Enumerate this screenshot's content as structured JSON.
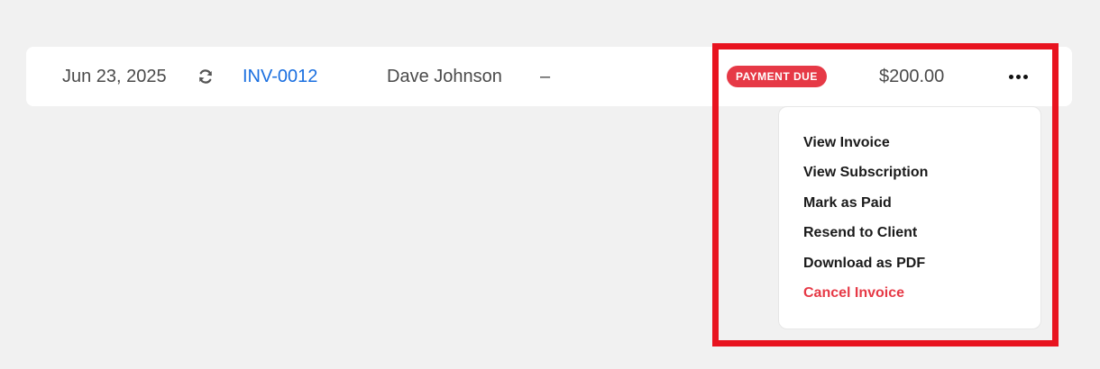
{
  "row": {
    "date": "Jun 23, 2025",
    "recurring_icon": "refresh-icon",
    "invoice_number": "INV-0012",
    "client": "Dave Johnson",
    "extra": "–",
    "status_badge": "PAYMENT DUE",
    "amount": "$200.00",
    "more_icon": "more-horizontal-icon"
  },
  "menu": {
    "items": [
      {
        "label": "View Invoice"
      },
      {
        "label": "View Subscription"
      },
      {
        "label": "Mark as Paid"
      },
      {
        "label": "Resend to Client"
      },
      {
        "label": "Download as PDF"
      },
      {
        "label": "Cancel Invoice"
      }
    ]
  },
  "colors": {
    "background": "#f1f1f1",
    "link": "#1a6fe0",
    "badge": "#e63946",
    "danger": "#e63946",
    "highlight": "#e8131f"
  }
}
